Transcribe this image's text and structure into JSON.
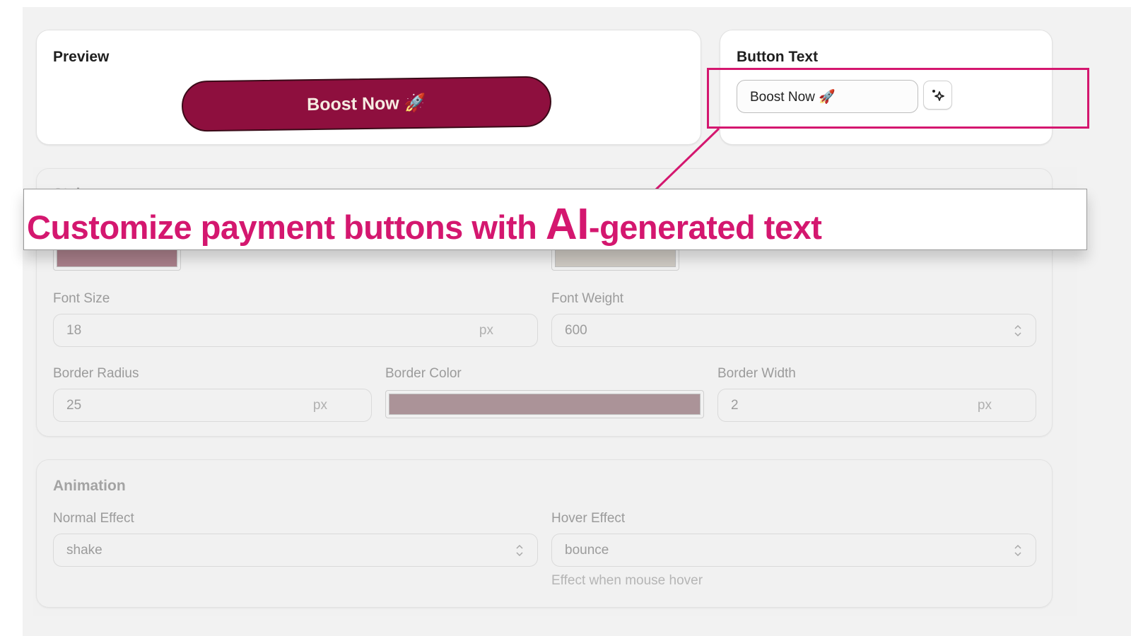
{
  "preview": {
    "title": "Preview",
    "button_label": "Boost Now 🚀",
    "button_bg": "#8e0f3e",
    "button_text_color": "#f6ece2"
  },
  "button_text": {
    "title": "Button Text",
    "value": "Boost Now 🚀",
    "ai_icon": "sparkles-icon"
  },
  "style": {
    "title": "Style",
    "background_color_swatch": "#a97f8a",
    "text_color_swatch": "#cfcac3",
    "font_size": {
      "label": "Font Size",
      "value": "18",
      "unit": "px"
    },
    "font_weight": {
      "label": "Font Weight",
      "value": "600"
    },
    "border_radius": {
      "label": "Border Radius",
      "value": "25",
      "unit": "px"
    },
    "border_color": {
      "label": "Border Color",
      "swatch": "#ab9398"
    },
    "border_width": {
      "label": "Border Width",
      "value": "2",
      "unit": "px"
    }
  },
  "animation": {
    "title": "Animation",
    "normal_effect": {
      "label": "Normal Effect",
      "value": "shake"
    },
    "hover_effect": {
      "label": "Hover Effect",
      "value": "bounce",
      "helper": "Effect when mouse hover"
    }
  },
  "annotation": {
    "prefix": "Customize payment buttons with ",
    "emphasis": "AI",
    "suffix": "-generated text",
    "color": "#d4176f"
  }
}
